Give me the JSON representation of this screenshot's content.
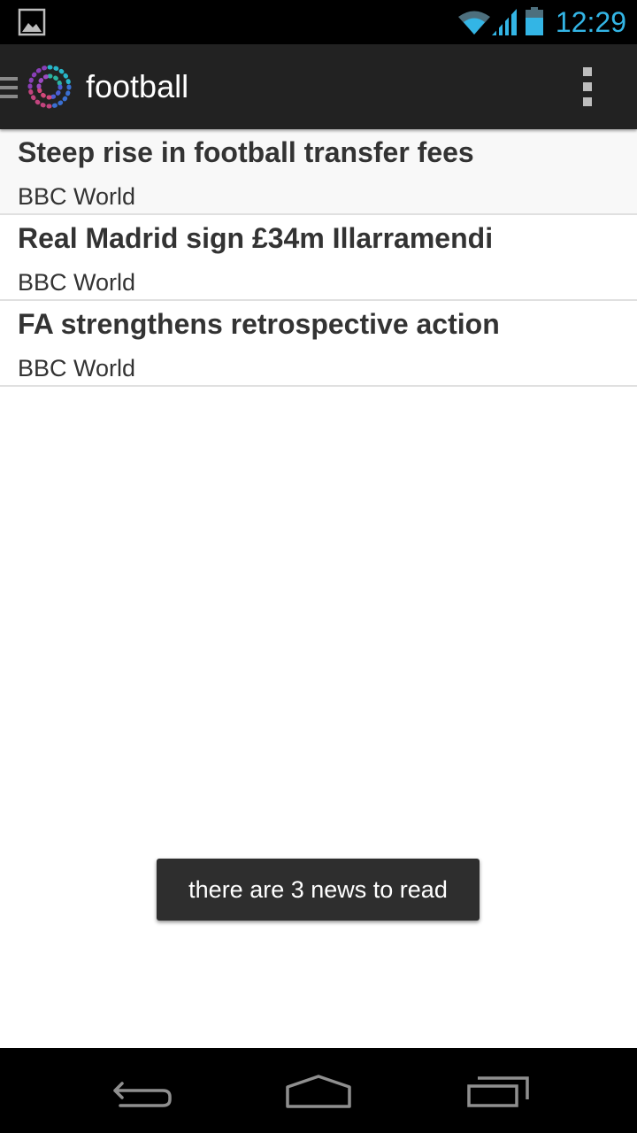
{
  "status_bar": {
    "time": "12:29",
    "icons": [
      "image-notification-icon",
      "wifi-icon",
      "cell-signal-icon",
      "battery-icon"
    ],
    "accent_color": "#33b5e5"
  },
  "action_bar": {
    "title": "football",
    "icons": [
      "drawer-menu-icon",
      "app-logo-icon",
      "overflow-menu-icon"
    ]
  },
  "news": {
    "items": [
      {
        "title": "Steep rise in football transfer fees",
        "source": "BBC World"
      },
      {
        "title": "Real Madrid sign £34m Illarramendi",
        "source": "BBC World"
      },
      {
        "title": "FA strengthens retrospective action",
        "source": "BBC World"
      }
    ]
  },
  "toast": {
    "message": "there are 3 news to read"
  },
  "nav_bar": {
    "icons": [
      "back-icon",
      "home-icon",
      "recent-apps-icon"
    ]
  }
}
